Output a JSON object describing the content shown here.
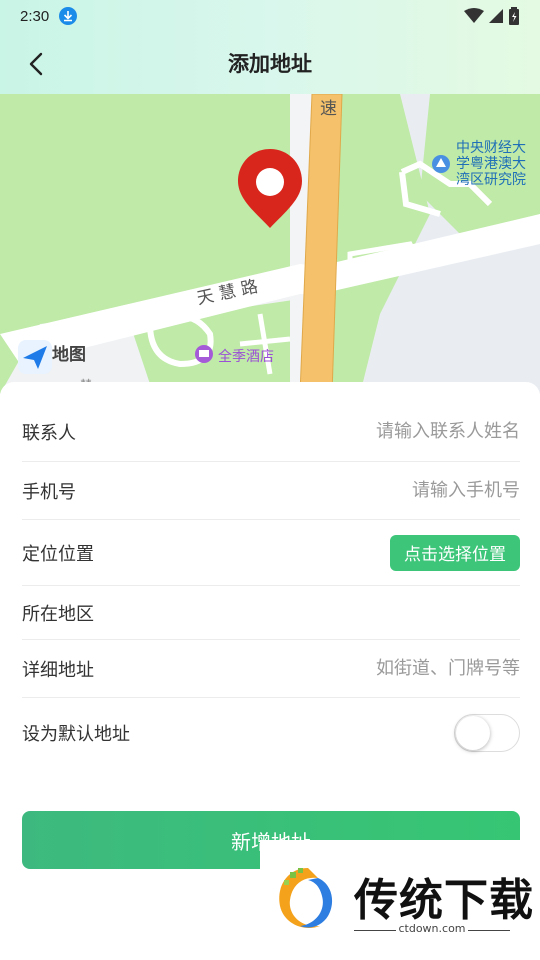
{
  "status_bar": {
    "time": "2:30"
  },
  "header": {
    "title": "添加地址"
  },
  "map": {
    "road_highway": "速",
    "road_name": "天 慧 路",
    "poi_university": [
      "中央财经大",
      "学粤港澳大",
      "湾区研究院"
    ],
    "poi_hotel": "全季酒店",
    "logo_text": "高德地图",
    "partial_label": "彗"
  },
  "form": {
    "contact": {
      "label": "联系人",
      "placeholder": "请输入联系人姓名"
    },
    "phone": {
      "label": "手机号",
      "placeholder": "请输入手机号"
    },
    "location": {
      "label": "定位位置",
      "button": "点击选择位置"
    },
    "region": {
      "label": "所在地区"
    },
    "detail": {
      "label": "详细地址",
      "placeholder": "如街道、门牌号等"
    },
    "default": {
      "label": "设为默认地址",
      "enabled": false
    },
    "submit": "新增地址"
  },
  "watermark": {
    "title": "传统下载",
    "url": "ctdown.com"
  },
  "colors": {
    "accent": "#3dc57a",
    "pin": "#d9261c",
    "map_green": "#bfeaa7",
    "highway": "#f5c26b"
  }
}
